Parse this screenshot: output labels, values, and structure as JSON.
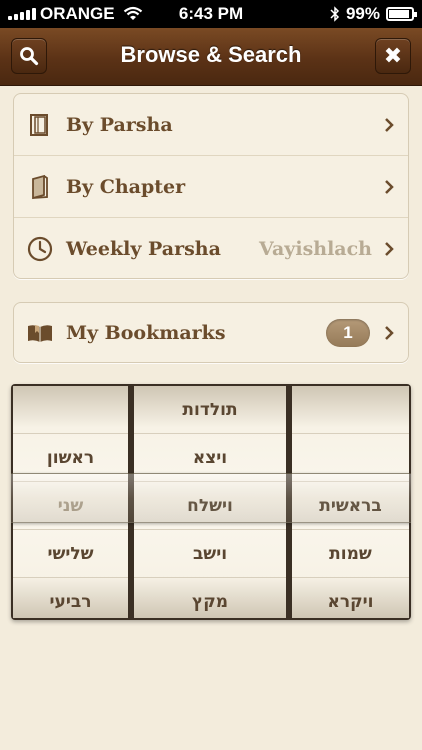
{
  "status_bar": {
    "carrier": "ORANGE",
    "time": "6:43 PM",
    "battery": "99%"
  },
  "navbar": {
    "title": "Browse & Search"
  },
  "menu": {
    "items": [
      {
        "label": "By Parsha",
        "icon": "scroll-door-icon"
      },
      {
        "label": "By Chapter",
        "icon": "book-icon"
      },
      {
        "label": "Weekly Parsha",
        "detail": "Vayishlach",
        "icon": "clock-icon"
      }
    ]
  },
  "bookmarks": {
    "label": "My Bookmarks",
    "count": "1",
    "icon": "open-book-icon"
  },
  "picker": {
    "columns": [
      {
        "cells": [
          "",
          "ראשון",
          "שני",
          "שלישי",
          "רביעי"
        ]
      },
      {
        "cells": [
          "תולדות",
          "ויצא",
          "וישלח",
          "וישב",
          "מקץ"
        ]
      },
      {
        "cells": [
          "",
          "",
          "בראשית",
          "שמות",
          "ויקרא"
        ]
      }
    ],
    "selected_index": 2
  },
  "colors": {
    "nav_brown": "#5b3216",
    "label_brown": "#6b4c2c",
    "detail_gray": "#b8ab94",
    "background": "#f3ecdc"
  }
}
